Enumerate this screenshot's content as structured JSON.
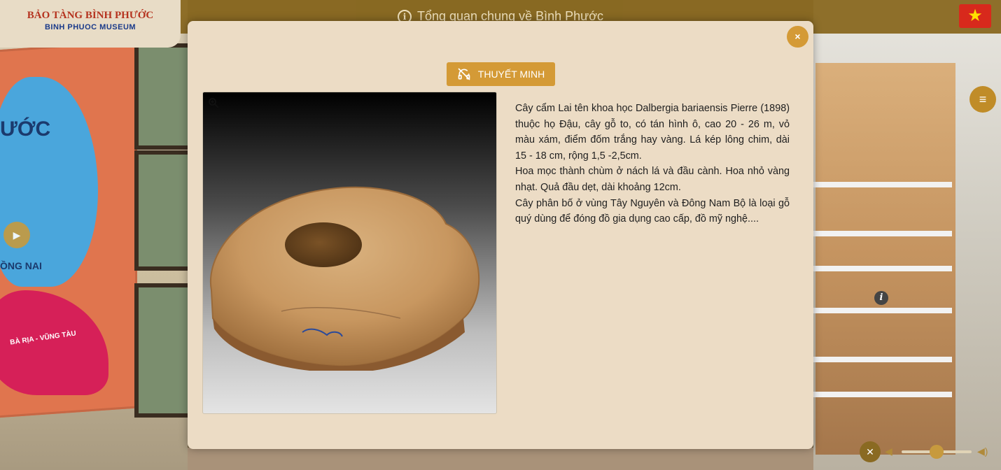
{
  "header": {
    "title": "Tổng quan chung về Bình Phước",
    "logo_line1": "BẢO TÀNG BÌNH PHƯỚC",
    "logo_line2": "BINH PHUOC MUSEUM"
  },
  "background": {
    "map_label_1": "ƯỚC",
    "map_label_2": "ỒNG NAI",
    "map_label_3": "BÀ RỊA - VŨNG TÀU"
  },
  "modal": {
    "close_label": "×",
    "narrate_label": "THUYẾT MINH",
    "description": [
      "Cây cẩm Lai tên khoa học Dalbergia bariaensis Pierre (1898) thuộc họ Đậu, cây gỗ to, có tán hình ô, cao 20 - 26 m, vỏ màu xám, điểm đốm trắng hay vàng. Lá kép lông chim, dài 15 - 18 cm, rộng 1,5 -2,5cm.",
      "Hoa mọc thành chùm ở nách lá và đầu cành. Hoa nhỏ vàng nhạt. Quả đầu dẹt, dài khoảng 12cm.",
      "Cây phân bố ở vùng Tây Nguyên và Đông Nam Bộ là loại gỗ quý dùng để đóng đồ gia dụng cao cấp, đồ mỹ nghệ...."
    ]
  },
  "icons": {
    "info": "info-icon",
    "flag": "vietnam-flag-icon",
    "close": "close-icon",
    "narrate": "headphones-off-icon",
    "zoom": "zoom-icon",
    "menu": "hamburger-menu-icon",
    "arrow": "chevron-right-icon",
    "hotspot": "info-hotspot-icon",
    "mute": "volume-mute-icon"
  },
  "colors": {
    "accent": "#d49a36",
    "modal_bg": "#ecdcc5",
    "header_bg": "#8a6a22"
  },
  "audio": {
    "volume": 0.5
  }
}
